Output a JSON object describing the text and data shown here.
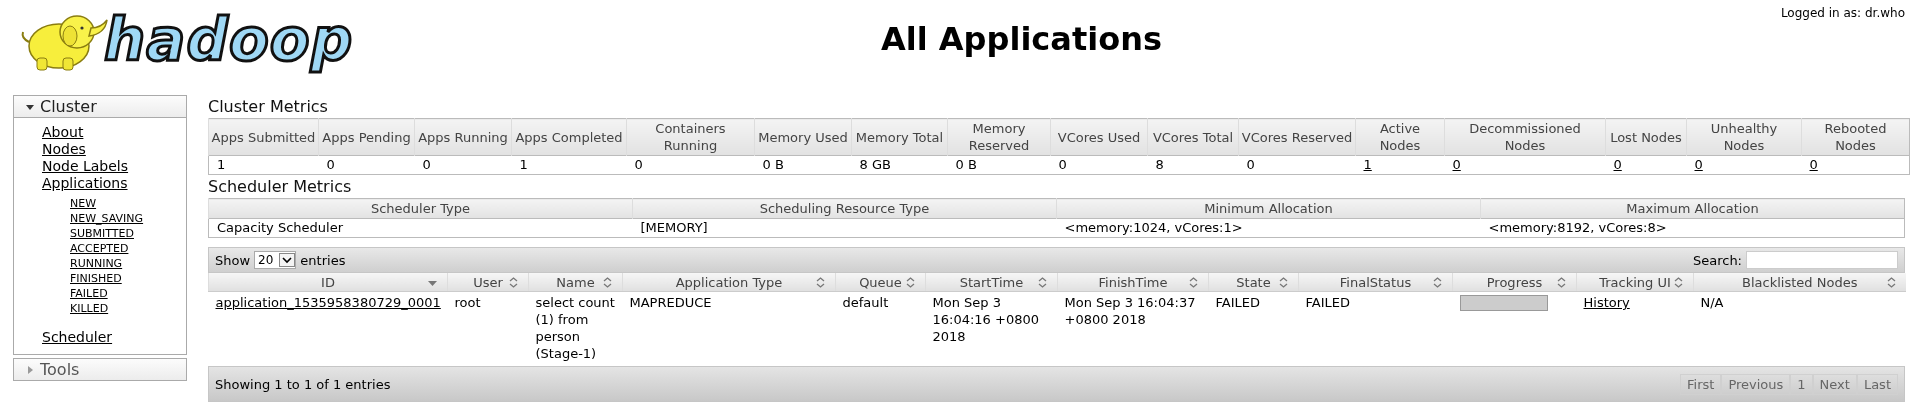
{
  "header": {
    "logo_text": "hadoop",
    "title": "All Applications",
    "login": "Logged in as: dr.who"
  },
  "sidebar": [
    {
      "label": "Cluster",
      "expanded": true,
      "items": [
        {
          "label": "About"
        },
        {
          "label": "Nodes"
        },
        {
          "label": "Node Labels"
        },
        {
          "label": "Applications",
          "children": [
            {
              "label": "NEW"
            },
            {
              "label": "NEW_SAVING"
            },
            {
              "label": "SUBMITTED"
            },
            {
              "label": "ACCEPTED"
            },
            {
              "label": "RUNNING"
            },
            {
              "label": "FINISHED"
            },
            {
              "label": "FAILED"
            },
            {
              "label": "KILLED"
            }
          ]
        },
        {
          "label": "Scheduler"
        }
      ]
    },
    {
      "label": "Tools",
      "expanded": false
    }
  ],
  "cluster_metrics": {
    "title": "Cluster Metrics",
    "columns": [
      "Apps Submitted",
      "Apps Pending",
      "Apps Running",
      "Apps Completed",
      "Containers Running",
      "Memory Used",
      "Memory Total",
      "Memory Reserved",
      "VCores Used",
      "VCores Total",
      "VCores Reserved",
      "Active Nodes",
      "Decommissioned Nodes",
      "Lost Nodes",
      "Unhealthy Nodes",
      "Rebooted Nodes"
    ],
    "values": [
      {
        "kind": "text",
        "text": "1"
      },
      {
        "kind": "text",
        "text": "0"
      },
      {
        "kind": "text",
        "text": "0"
      },
      {
        "kind": "text",
        "text": "1"
      },
      {
        "kind": "text",
        "text": "0"
      },
      {
        "kind": "text",
        "text": "0 B"
      },
      {
        "kind": "text",
        "text": "8 GB"
      },
      {
        "kind": "text",
        "text": "0 B"
      },
      {
        "kind": "text",
        "text": "0"
      },
      {
        "kind": "text",
        "text": "8"
      },
      {
        "kind": "text",
        "text": "0"
      },
      {
        "kind": "link",
        "text": "1"
      },
      {
        "kind": "link",
        "text": "0"
      },
      {
        "kind": "link",
        "text": "0"
      },
      {
        "kind": "link",
        "text": "0"
      },
      {
        "kind": "link",
        "text": "0"
      }
    ]
  },
  "scheduler_metrics": {
    "title": "Scheduler Metrics",
    "columns": [
      "Scheduler Type",
      "Scheduling Resource Type",
      "Minimum Allocation",
      "Maximum Allocation"
    ],
    "rows": [
      [
        "Capacity Scheduler",
        "[MEMORY]",
        "<memory:1024, vCores:1>",
        "<memory:8192, vCores:8>"
      ]
    ]
  },
  "applications": {
    "show_label": "Show",
    "page_size": "20",
    "entries_label": "entries",
    "search_label": "Search:",
    "columns": [
      {
        "label": "ID",
        "sorted": true
      },
      {
        "label": "User",
        "sorted": false
      },
      {
        "label": "Name",
        "sorted": false
      },
      {
        "label": "Application Type",
        "sorted": false
      },
      {
        "label": "Queue",
        "sorted": false
      },
      {
        "label": "StartTime",
        "sorted": false
      },
      {
        "label": "FinishTime",
        "sorted": false
      },
      {
        "label": "State",
        "sorted": false
      },
      {
        "label": "FinalStatus",
        "sorted": false
      },
      {
        "label": "Progress",
        "sorted": false
      },
      {
        "label": "Tracking UI",
        "sorted": false
      },
      {
        "label": "Blacklisted Nodes",
        "sorted": false
      }
    ],
    "rows": [
      {
        "cells": [
          {
            "kind": "link",
            "text": "application_1535958380729_0001"
          },
          {
            "kind": "text",
            "text": "root"
          },
          {
            "kind": "text",
            "text": "select count (1) from person (Stage-1)"
          },
          {
            "kind": "text",
            "text": "MAPREDUCE"
          },
          {
            "kind": "text",
            "text": "default"
          },
          {
            "kind": "text",
            "text": "Mon Sep 3 16:04:16 +0800 2018"
          },
          {
            "kind": "text",
            "text": "Mon Sep 3 16:04:37 +0800 2018"
          },
          {
            "kind": "text",
            "text": "FAILED"
          },
          {
            "kind": "text",
            "text": "FAILED"
          },
          {
            "kind": "progress",
            "level": 0
          },
          {
            "kind": "link",
            "text": "History"
          },
          {
            "kind": "text",
            "text": "N/A"
          }
        ]
      }
    ],
    "info": "Showing 1 to 1 of 1 entries",
    "pager": [
      {
        "label": "First",
        "disabled": true
      },
      {
        "label": "Previous",
        "disabled": true
      },
      {
        "label": "1",
        "disabled": true
      },
      {
        "label": "Next",
        "disabled": true
      },
      {
        "label": "Last",
        "disabled": true
      }
    ]
  }
}
